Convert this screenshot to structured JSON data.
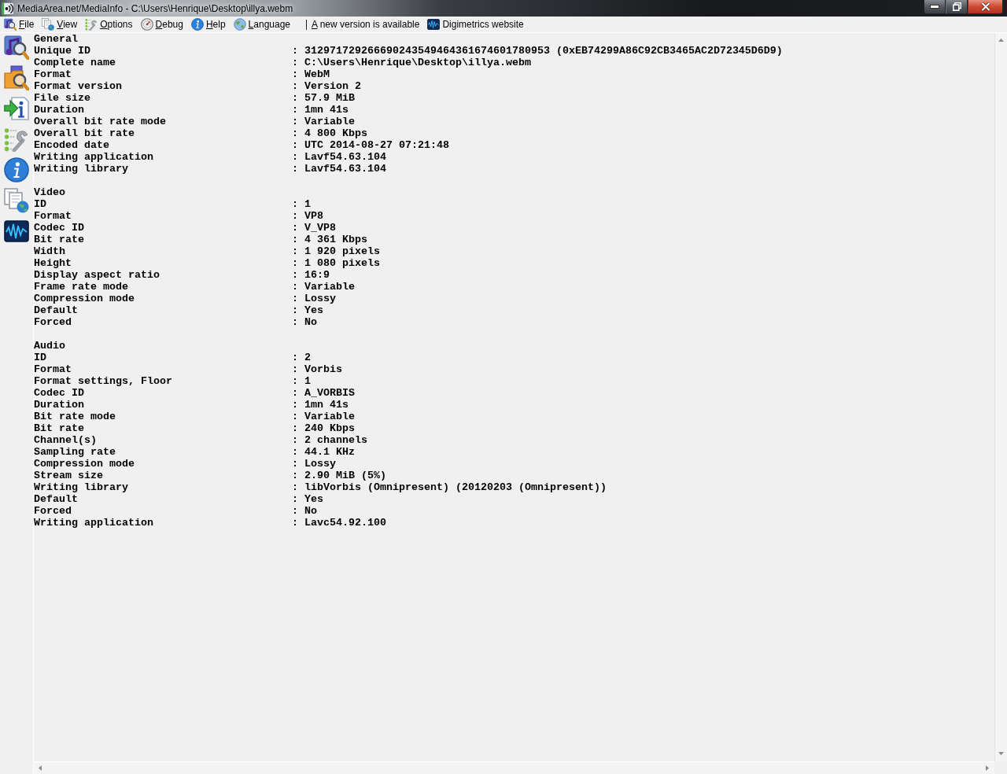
{
  "window": {
    "title": "MediaArea.net/MediaInfo - C:\\Users\\Henrique\\Desktop\\illya.webm"
  },
  "menu": [
    {
      "label": "File",
      "accelerator": true
    },
    {
      "label": "View",
      "accelerator": true
    },
    {
      "label": "Options",
      "accelerator": true
    },
    {
      "label": "Debug",
      "accelerator": true
    },
    {
      "label": "Help",
      "accelerator": true
    },
    {
      "label": "Language",
      "accelerator": true
    }
  ],
  "links": [
    {
      "label": "A new version is available",
      "accelerator": true
    },
    {
      "label": "Digimetrics website",
      "accelerator": false
    }
  ],
  "report": {
    "sections": [
      {
        "title": "General",
        "rows": [
          {
            "label": "Unique ID",
            "separator": ":",
            "value": "312971729266690243549464361674601780953 (0xEB74299A86C92CB3465AC2D72345D6D9)"
          },
          {
            "label": "Complete name",
            "separator": ":",
            "value": "C:\\Users\\Henrique\\Desktop\\illya.webm"
          },
          {
            "label": "Format",
            "separator": ":",
            "value": "WebM"
          },
          {
            "label": "Format version",
            "separator": ":",
            "value": "Version 2"
          },
          {
            "label": "File size",
            "separator": ":",
            "value": "57.9 MiB"
          },
          {
            "label": "Duration",
            "separator": ":",
            "value": "1mn 41s"
          },
          {
            "label": "Overall bit rate mode",
            "separator": ":",
            "value": "Variable"
          },
          {
            "label": "Overall bit rate",
            "separator": ":",
            "value": "4 800 Kbps"
          },
          {
            "label": "Encoded date",
            "separator": ":",
            "value": "UTC 2014-08-27 07:21:48"
          },
          {
            "label": "Writing application",
            "separator": ":",
            "value": "Lavf54.63.104"
          },
          {
            "label": "Writing library",
            "separator": ":",
            "value": "Lavf54.63.104"
          }
        ]
      },
      {
        "title": "Video",
        "rows": [
          {
            "label": "ID",
            "separator": ":",
            "value": "1"
          },
          {
            "label": "Format",
            "separator": ":",
            "value": "VP8"
          },
          {
            "label": "Codec ID",
            "separator": ":",
            "value": "V_VP8"
          },
          {
            "label": "Bit rate",
            "separator": ":",
            "value": "4 361 Kbps"
          },
          {
            "label": "Width",
            "separator": ":",
            "value": "1 920 pixels"
          },
          {
            "label": "Height",
            "separator": ":",
            "value": "1 080 pixels"
          },
          {
            "label": "Display aspect ratio",
            "separator": ":",
            "value": "16:9"
          },
          {
            "label": "Frame rate mode",
            "separator": ":",
            "value": "Variable"
          },
          {
            "label": "Compression mode",
            "separator": ":",
            "value": "Lossy"
          },
          {
            "label": "Default",
            "separator": ":",
            "value": "Yes"
          },
          {
            "label": "Forced",
            "separator": ":",
            "value": "No"
          }
        ]
      },
      {
        "title": "Audio",
        "rows": [
          {
            "label": "ID",
            "separator": ":",
            "value": "2"
          },
          {
            "label": "Format",
            "separator": ":",
            "value": "Vorbis"
          },
          {
            "label": "Format settings, Floor",
            "separator": ":",
            "value": "1"
          },
          {
            "label": "Codec ID",
            "separator": ":",
            "value": "A_VORBIS"
          },
          {
            "label": "Duration",
            "separator": ":",
            "value": "1mn 41s"
          },
          {
            "label": "Bit rate mode",
            "separator": ":",
            "value": "Variable"
          },
          {
            "label": "Bit rate",
            "separator": ":",
            "value": "240 Kbps"
          },
          {
            "label": "Channel(s)",
            "separator": ":",
            "value": "2 channels"
          },
          {
            "label": "Sampling rate",
            "separator": ":",
            "value": "44.1 KHz"
          },
          {
            "label": "Compression mode",
            "separator": ":",
            "value": "Lossy"
          },
          {
            "label": "Stream size",
            "separator": ":",
            "value": "2.90 MiB (5%)"
          },
          {
            "label": "Writing library",
            "separator": ":",
            "value": "libVorbis (Omnipresent) (20120203 (Omnipresent))"
          },
          {
            "label": "Default",
            "separator": ":",
            "value": "Yes"
          },
          {
            "label": "Forced",
            "separator": ":",
            "value": "No"
          },
          {
            "label": "Writing application",
            "separator": ":",
            "value": "Lavc54.92.100"
          }
        ]
      }
    ]
  }
}
